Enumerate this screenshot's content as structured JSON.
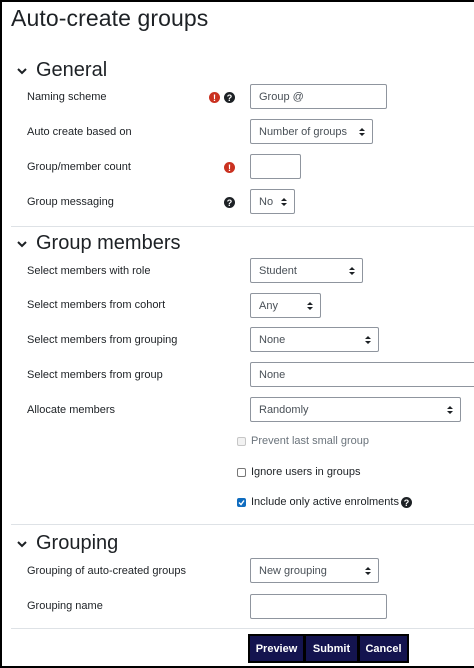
{
  "page_title": "Auto-create groups",
  "sections": {
    "general": {
      "title": "General",
      "naming_scheme": {
        "label": "Naming scheme",
        "value": "Group @"
      },
      "auto_create_based_on": {
        "label": "Auto create based on",
        "value": "Number of groups"
      },
      "group_member_count": {
        "label": "Group/member count",
        "value": ""
      },
      "group_messaging": {
        "label": "Group messaging",
        "value": "No"
      }
    },
    "group_members": {
      "title": "Group members",
      "select_role": {
        "label": "Select members with role",
        "value": "Student"
      },
      "select_cohort": {
        "label": "Select members from cohort",
        "value": "Any"
      },
      "select_grouping": {
        "label": "Select members from grouping",
        "value": "None"
      },
      "select_group": {
        "label": "Select members from group",
        "value": "None"
      },
      "allocate": {
        "label": "Allocate members",
        "value": "Randomly"
      },
      "checkboxes": [
        {
          "label": "Prevent last small group",
          "checked": false,
          "disabled": true
        },
        {
          "label": "Ignore users in groups",
          "checked": false,
          "disabled": false
        },
        {
          "label": "Include only active enrolments",
          "checked": true,
          "disabled": false
        }
      ]
    },
    "grouping": {
      "title": "Grouping",
      "grouping_of_groups": {
        "label": "Grouping of auto-created groups",
        "value": "New grouping"
      },
      "grouping_name": {
        "label": "Grouping name",
        "value": ""
      }
    }
  },
  "buttons": {
    "preview": "Preview",
    "submit": "Submit",
    "cancel": "Cancel"
  },
  "colors": {
    "primary": "#14144f",
    "required": "#ca3120",
    "checkbox": "#0f6cbf"
  }
}
